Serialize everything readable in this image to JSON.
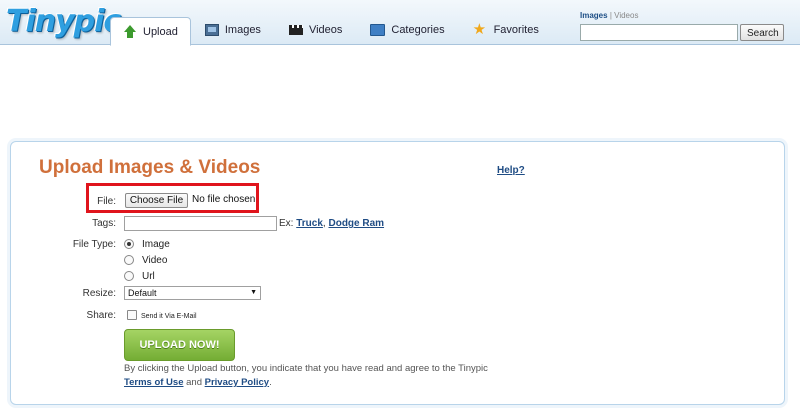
{
  "brand": {
    "logo_text": "Tinypic"
  },
  "nav": {
    "tabs": [
      {
        "label": "Upload",
        "icon": "upload-arrow-icon",
        "active": true
      },
      {
        "label": "Images",
        "icon": "images-icon",
        "active": false
      },
      {
        "label": "Videos",
        "icon": "videos-icon",
        "active": false
      },
      {
        "label": "Categories",
        "icon": "categories-folder-icon",
        "active": false
      },
      {
        "label": "Favorites",
        "icon": "favorites-star-icon",
        "active": false
      }
    ]
  },
  "search": {
    "scope_images": "Images",
    "separator": "|",
    "scope_videos": "Videos",
    "value": "",
    "button_label": "Search"
  },
  "upload": {
    "title": "Upload Images & Videos",
    "help_link": "Help?",
    "file_label": "File:",
    "choose_file_button": "Choose File",
    "no_file_text": "No file chosen",
    "tags_label": "Tags:",
    "tags_value": "",
    "tags_example_prefix": "Ex:",
    "tags_example_1": "Truck",
    "tags_example_sep": ",",
    "tags_example_2": "Dodge Ram",
    "file_type_label": "File Type:",
    "file_types": [
      {
        "label": "Image",
        "selected": true
      },
      {
        "label": "Video",
        "selected": false
      },
      {
        "label": "Url",
        "selected": false
      }
    ],
    "resize_label": "Resize:",
    "resize_value": "Default",
    "share_label": "Share:",
    "share_option": "Send it Via E-Mail",
    "share_checked": false,
    "submit_button": "UPLOAD NOW!",
    "agree_text": "By clicking the Upload button, you indicate that you have read and agree to the Tinypic",
    "terms_link": "Terms of Use",
    "and_text": "and",
    "privacy_link": "Privacy Policy",
    "period": "."
  },
  "colors": {
    "title_orange": "#d0703b",
    "link_blue": "#1f4c84",
    "highlight_red": "#e0141c",
    "button_green": "#8bc34a"
  }
}
